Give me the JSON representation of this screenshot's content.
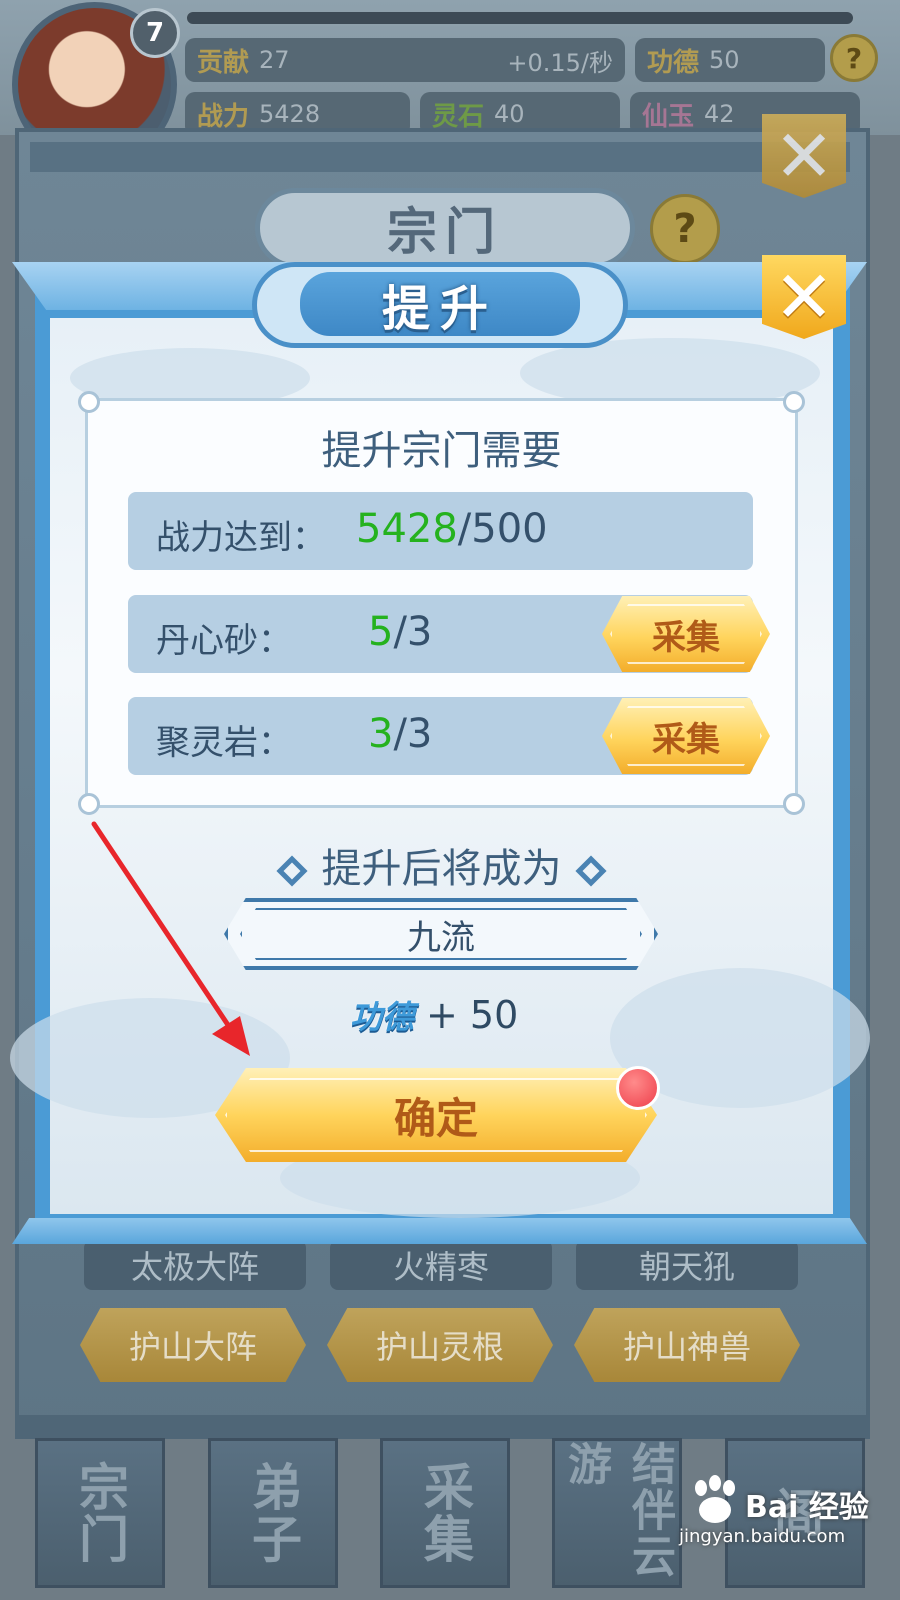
{
  "hud": {
    "level": "7",
    "resources": {
      "gongxian_label": "贡献",
      "gongxian_value": "27",
      "gongxian_rate": "+0.15/秒",
      "gongde_label": "功德",
      "gongde_value": "50",
      "zhanli_label": "战力",
      "zhanli_value": "5428",
      "lingshi_label": "灵石",
      "lingshi_value": "40",
      "xianyu_label": "仙玉",
      "xianyu_value": "42"
    }
  },
  "background_panel": {
    "title": "宗门",
    "tags": [
      "太极大阵",
      "火精枣",
      "朝天犼"
    ],
    "buttons": [
      "护山大阵",
      "护山灵根",
      "护山神兽"
    ],
    "nav": [
      "宗门",
      "弟子",
      "采集",
      "结伴云游",
      "阁"
    ]
  },
  "dialog": {
    "title": "提升",
    "requirements_title": "提升宗门需要",
    "requirements": [
      {
        "label": "战力达到：",
        "have": "5428",
        "need": "/500",
        "action": ""
      },
      {
        "label": "丹心砂：",
        "have": "5",
        "need": "/3",
        "action": "采集"
      },
      {
        "label": "聚灵岩：",
        "have": "3",
        "need": "/3",
        "action": "采集"
      }
    ],
    "after_title": "提升后将成为",
    "new_rank": "九流",
    "reward_label": "功德",
    "reward_amount": "+ 50",
    "confirm_label": "确定"
  },
  "watermark": {
    "brand": "Bai  经验",
    "url": "jingyan.baidu.com"
  },
  "colors": {
    "accent_blue": "#4b9bd5",
    "gold_button": "#ffd45c",
    "have_green": "#25b21e",
    "annotation_red": "#e8262b"
  }
}
